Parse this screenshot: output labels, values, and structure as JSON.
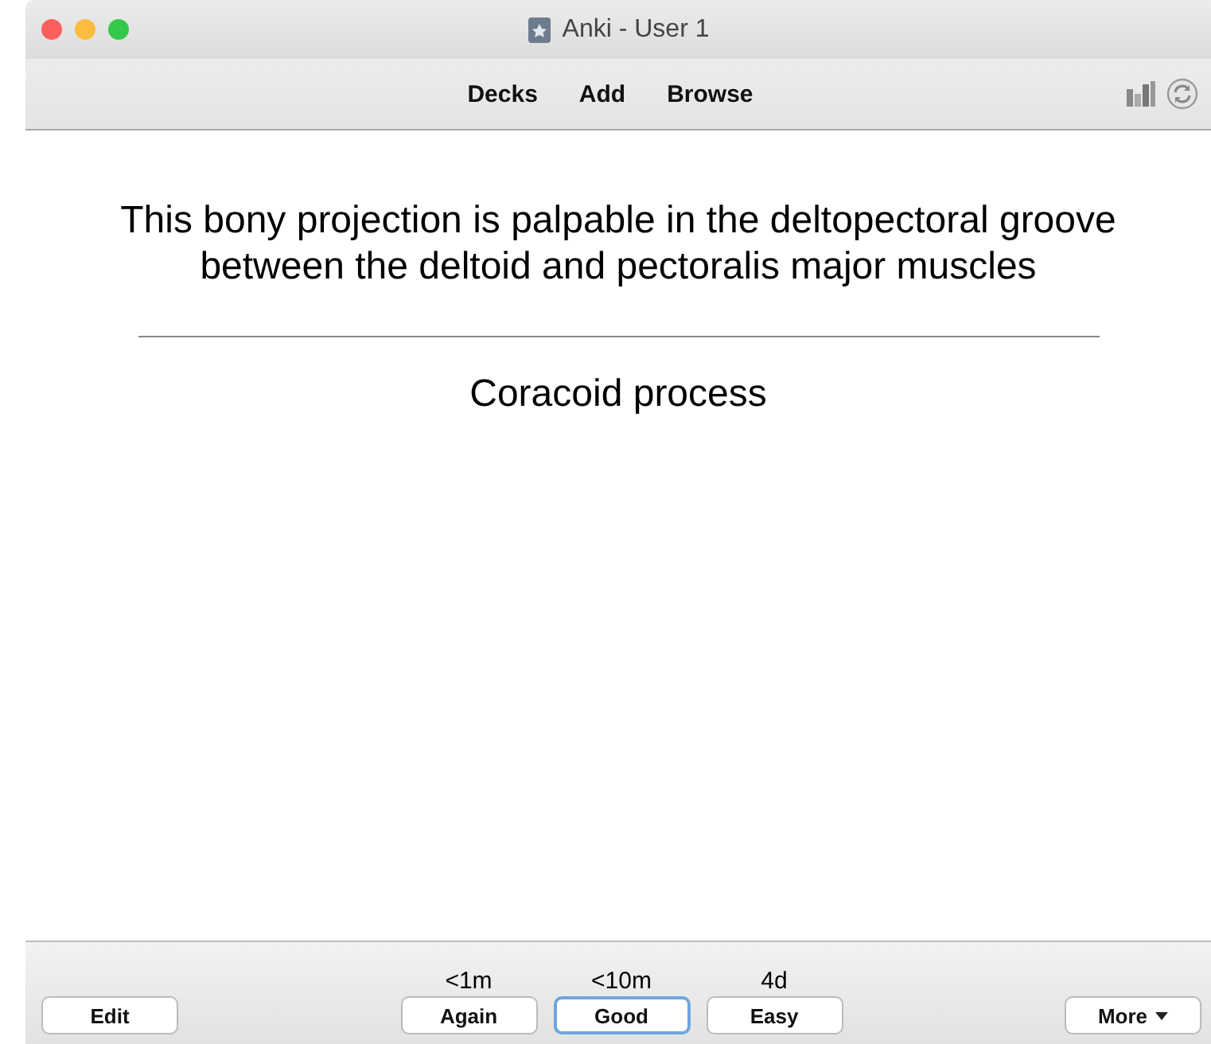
{
  "window": {
    "title": "Anki - User 1"
  },
  "toolbar": {
    "links": [
      "Decks",
      "Add",
      "Browse"
    ]
  },
  "card": {
    "question": "This bony projection is palpable in the deltopectoral groove between the deltoid and pectoralis major muscles",
    "answer": "Coracoid process"
  },
  "bottom_bar": {
    "edit": "Edit",
    "answers": [
      {
        "interval": "<1m",
        "label": "Again",
        "selected": false
      },
      {
        "interval": "<10m",
        "label": "Good",
        "selected": true
      },
      {
        "interval": "4d",
        "label": "Easy",
        "selected": false
      }
    ],
    "more": "More"
  }
}
